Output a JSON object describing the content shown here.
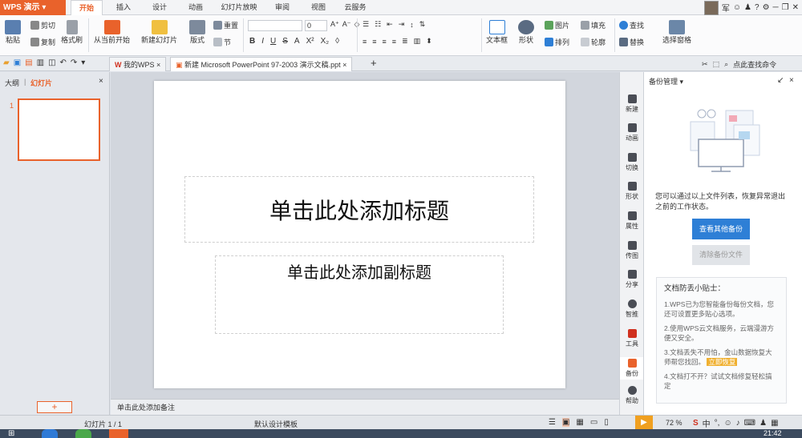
{
  "app": {
    "title": "WPS 演示"
  },
  "menu_tabs": [
    "开始",
    "插入",
    "设计",
    "动画",
    "幻灯片放映",
    "审阅",
    "视图",
    "云服务"
  ],
  "window": {
    "user": "军"
  },
  "ribbon": {
    "paste": "粘贴",
    "cut": "剪切",
    "copy": "复制",
    "format_painter": "格式刷",
    "from_current": "从当前开始",
    "new_slide": "新建幻灯片",
    "layout": "版式",
    "section": "节",
    "reset": "重置",
    "font_size": "0",
    "textbox": "文本框",
    "shape": "形状",
    "picture": "图片",
    "fill": "填充",
    "arrange": "排列",
    "outline": "轮廓",
    "find": "查找",
    "replace": "替换",
    "select_pane": "选择窗格"
  },
  "doc_tabs": {
    "home": "我的WPS",
    "active": "新建 Microsoft PowerPoint 97-2003 演示文稿.ppt",
    "command_search": "点此查找命令"
  },
  "left_panel": {
    "tab_outline": "大纲",
    "tab_slides": "幻灯片",
    "slide_number": "1",
    "add_button": "+"
  },
  "slide": {
    "title_placeholder": "单击此处添加标题",
    "subtitle_placeholder": "单击此处添加副标题"
  },
  "notes": {
    "placeholder": "单击此处添加备注"
  },
  "side_tools": [
    "新建",
    "动画",
    "切换",
    "形状",
    "属性",
    "传图",
    "分享",
    "智推",
    "工具",
    "备份",
    "帮助"
  ],
  "backup": {
    "title": "备份管理",
    "description": "您可以通过以上文件列表，恢复异常退出之前的工作状态。",
    "view_other_button": "查看其他备份",
    "clear_button": "清除备份文件",
    "tips_title": "文档防丢小贴士：",
    "tip1": "1.WPS已为您智能备份每份文档，您还可设置更多贴心选项。",
    "tip2": "2.使用WPS云文档服务，云端漫游方便又安全。",
    "tip3": "3.文档丢失不用怕，金山数据恢复大师帮您找回。",
    "tip3_link": "立即恢复",
    "tip4": "4.文档打不开？试试文档修复轻松搞定"
  },
  "status": {
    "slide_info": "幻灯片 1 / 1",
    "template": "默认设计模板",
    "zoom": "72 %"
  },
  "taskbar": {
    "time": "21:42"
  },
  "colors": {
    "accent": "#e9622b",
    "primary_button": "#2e7fd6"
  }
}
